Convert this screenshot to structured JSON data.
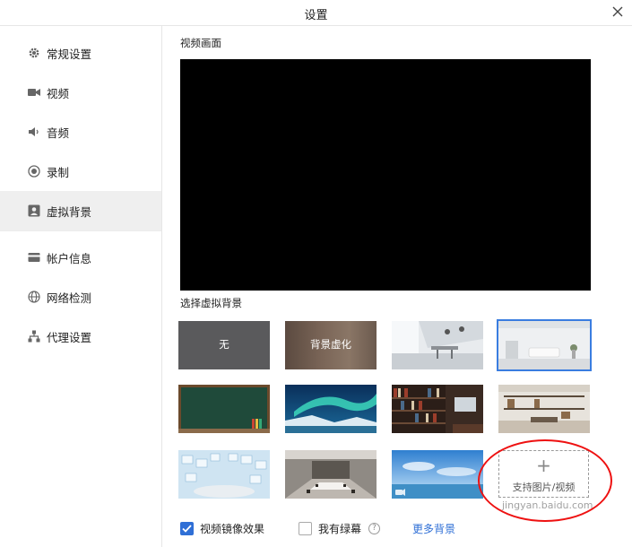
{
  "window": {
    "title": "设置",
    "close_icon": "close-icon"
  },
  "sidebar": {
    "items": [
      {
        "label": "常规设置",
        "icon": "gear-icon"
      },
      {
        "label": "视频",
        "icon": "camera-icon"
      },
      {
        "label": "音频",
        "icon": "speaker-icon"
      },
      {
        "label": "录制",
        "icon": "record-icon"
      },
      {
        "label": "虚拟背景",
        "icon": "person-card-icon",
        "active": true
      },
      {
        "label": "帐户信息",
        "icon": "card-icon"
      },
      {
        "label": "网络检测",
        "icon": "globe-icon"
      },
      {
        "label": "代理设置",
        "icon": "network-tree-icon"
      }
    ]
  },
  "main": {
    "preview_label": "视频画面",
    "choose_label": "选择虚拟背景",
    "backgrounds": [
      {
        "label": "无",
        "kind": "none"
      },
      {
        "label": "背景虚化",
        "kind": "blur"
      },
      {
        "label": "",
        "kind": "office-bright"
      },
      {
        "label": "",
        "kind": "living-room",
        "selected": true
      },
      {
        "label": "",
        "kind": "chalkboard"
      },
      {
        "label": "",
        "kind": "aurora"
      },
      {
        "label": "",
        "kind": "bookshelf"
      },
      {
        "label": "",
        "kind": "shelf-room"
      },
      {
        "label": "",
        "kind": "cubes"
      },
      {
        "label": "",
        "kind": "meeting-room"
      },
      {
        "label": "",
        "kind": "sky-sea",
        "video": true
      }
    ],
    "add_button": {
      "plus": "+",
      "label": "支持图片/视频"
    },
    "mirror": {
      "label": "视频镜像效果",
      "checked": true
    },
    "greenscreen": {
      "label": "我有绿幕",
      "checked": false
    },
    "help": "?",
    "more_backgrounds": "更多背景"
  },
  "watermark": "jingyan.baidu.com",
  "colors": {
    "accent": "#2f6fd6",
    "annotation": "#e11111"
  }
}
